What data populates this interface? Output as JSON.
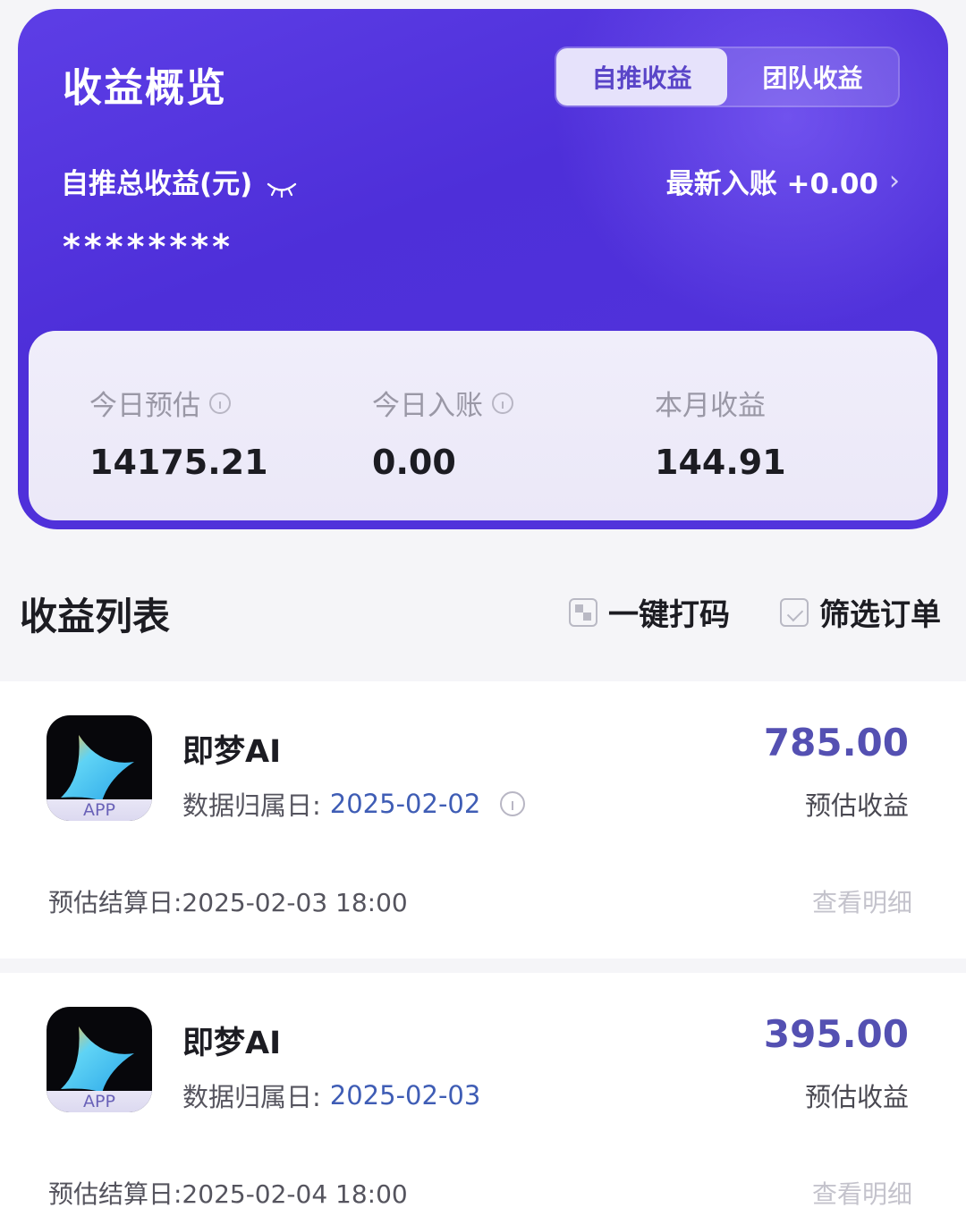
{
  "overview": {
    "title": "收益概览",
    "tabs": [
      {
        "label": "自推收益",
        "active": true
      },
      {
        "label": "团队收益",
        "active": false
      }
    ],
    "total_label": "自推总收益(元)",
    "masked_total": "********",
    "latest": "最新入账 +0.00",
    "stats": [
      {
        "label": "今日预估",
        "value": "14175.21"
      },
      {
        "label": "今日入账",
        "value": "0.00"
      },
      {
        "label": "本月收益",
        "value": "144.91"
      }
    ],
    "colors": {
      "card": "#5234dc",
      "accent": "#ff4d6d"
    }
  },
  "list": {
    "title": "收益列表",
    "mask_action": "一键打码",
    "filter_action": "筛选订单",
    "items": [
      {
        "app_name": "即梦AI",
        "app_badge": "APP",
        "date_prefix": "数据归属日:",
        "date": "2025-02-02",
        "amount": "785.00",
        "amount_label": "预估收益",
        "settle": "预估结算日:2025-02-03 18:00",
        "detail": "查看明细"
      },
      {
        "app_name": "即梦AI",
        "app_badge": "APP",
        "date_prefix": "数据归属日:",
        "date": "2025-02-03",
        "amount": "395.00",
        "amount_label": "预估收益",
        "settle": "预估结算日:2025-02-04 18:00",
        "detail": "查看明细"
      }
    ]
  }
}
